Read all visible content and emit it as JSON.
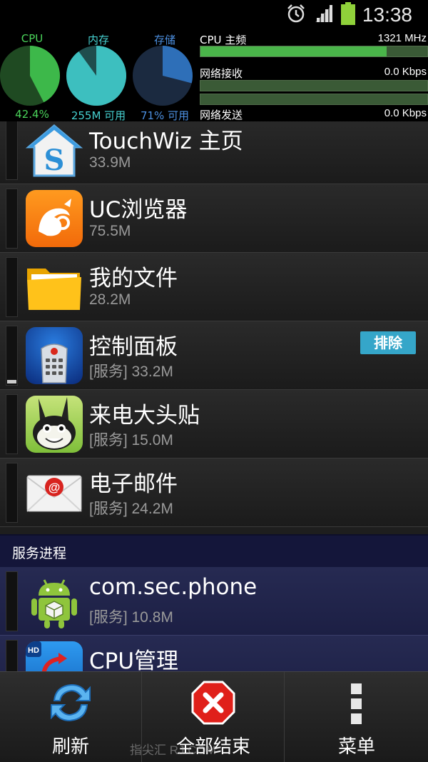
{
  "status_bar": {
    "time": "13:38",
    "icons": [
      "alarm-icon",
      "signal-icon",
      "battery-icon"
    ]
  },
  "stats": {
    "gauges": [
      {
        "title": "CPU",
        "value": "42.4%",
        "fraction": 0.424,
        "fill": "#3db84a",
        "bg": "#1f4a22",
        "title_color": "#4ad35a"
      },
      {
        "title": "内存",
        "value": "255M 可用",
        "fraction": 0.9,
        "fill": "#3dbfbf",
        "bg": "#1f4d4d",
        "title_color": "#46d0d0"
      },
      {
        "title": "存储",
        "value": "71% 可用",
        "fraction": 0.29,
        "fill": "#2e6fb8",
        "bg": "#1b2a40",
        "title_color": "#4c8fe0"
      }
    ],
    "cpu_freq_label": "CPU 主频",
    "cpu_freq_value": "1321 MHz",
    "cpu_freq_fraction": 0.82,
    "net_recv_label": "网络接收",
    "net_recv_value": "0.0 Kbps",
    "net_send_label": "网络发送",
    "net_send_value": "0.0 Kbps"
  },
  "apps": [
    {
      "name": "TouchWiz 主页",
      "mem": "33.9M",
      "icon": "touchwiz-home-icon"
    },
    {
      "name": "UC浏览器",
      "mem": "75.5M",
      "icon": "uc-browser-icon"
    },
    {
      "name": "我的文件",
      "mem": "28.2M",
      "icon": "my-files-folder-icon"
    },
    {
      "name": "控制面板",
      "mem": "[服务] 33.2M",
      "icon": "remote-control-icon",
      "action": "排除"
    },
    {
      "name": "来电大头贴",
      "mem": "[服务] 15.0M",
      "icon": "caller-rabbit-icon"
    },
    {
      "name": "电子邮件",
      "mem": "[服务] 24.2M",
      "icon": "email-icon"
    }
  ],
  "service_section": {
    "title": "服务进程",
    "items": [
      {
        "name": "com.sec.phone",
        "mem": "[服务] 10.8M",
        "icon": "android-package-icon"
      },
      {
        "name": "CPU管理",
        "mem": "",
        "icon": "cpu-manager-icon"
      }
    ]
  },
  "bottom_bar": {
    "refresh": "刷新",
    "end_all": "全部结束",
    "menu": "菜单",
    "watermark": "指尖汇    RJ.COM"
  },
  "colors": {
    "accent_blue": "#35a6c9",
    "service_row": "#262a52",
    "cpu_bar": "#4ab54a"
  }
}
